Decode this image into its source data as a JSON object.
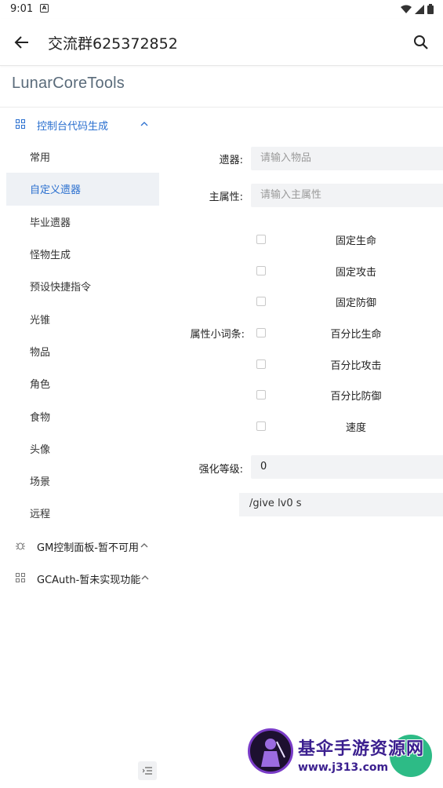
{
  "status_bar": {
    "time": "9:01",
    "notification_icon": "A"
  },
  "app_bar": {
    "title": "交流群625372852"
  },
  "brand": "LunarCoreTools",
  "menu": {
    "group1": {
      "label": "控制台代码生成"
    },
    "items": [
      "常用",
      "自定义遗器",
      "毕业遗器",
      "怪物生成",
      "预设快捷指令",
      "光锥",
      "物品",
      "角色",
      "食物",
      "头像",
      "场景",
      "远程"
    ],
    "group2": {
      "label": "GM控制面板-暂不可用"
    },
    "group3": {
      "label": "GCAuth-暂未实现功能"
    }
  },
  "form": {
    "relic": {
      "label": "遗器:",
      "placeholder": "请输入物品"
    },
    "main_stat": {
      "label": "主属性:",
      "placeholder": "请输入主属性"
    },
    "sub_stats": {
      "label": "属性小词条:",
      "options": [
        "固定生命",
        "固定攻击",
        "固定防御",
        "百分比生命",
        "百分比攻击",
        "百分比防御",
        "速度"
      ]
    },
    "level": {
      "label": "强化等级:",
      "value": "0"
    },
    "command": "/give  lv0 s"
  },
  "watermark": {
    "main": "基伞手游资源网",
    "sub": "www.j313.com"
  },
  "colors": {
    "accent": "#2a6fcf",
    "fab": "#2dbb86"
  }
}
